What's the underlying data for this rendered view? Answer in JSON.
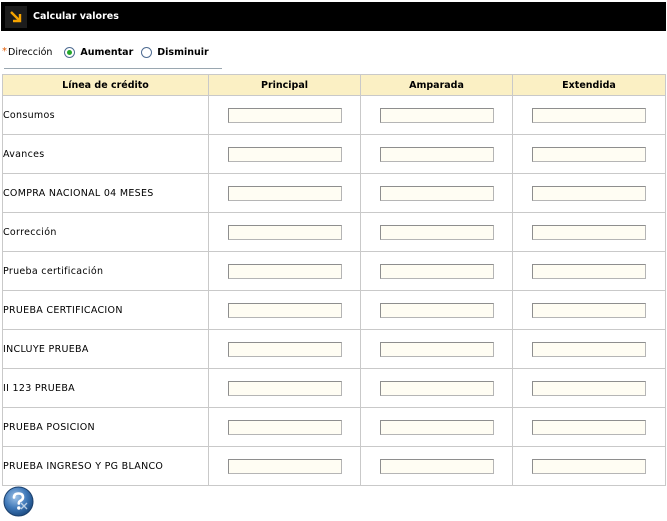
{
  "window": {
    "title": "Calcular valores"
  },
  "direction": {
    "label": "Dirección",
    "required_marker": "*",
    "options": [
      {
        "label": "Aumentar",
        "selected": true
      },
      {
        "label": "Disminuir",
        "selected": false
      }
    ]
  },
  "table": {
    "headers": [
      "Línea de crédito",
      "Principal",
      "Amparada",
      "Extendida"
    ],
    "rows": [
      {
        "name": "Consumos"
      },
      {
        "name": "Avances"
      },
      {
        "name": "COMPRA NACIONAL 04 MESES"
      },
      {
        "name": "Corrección"
      },
      {
        "name": "Prueba certificación"
      },
      {
        "name": "PRUEBA CERTIFICACION"
      },
      {
        "name": "INCLUYE PRUEBA"
      },
      {
        "name": "II 123 PRUEBA"
      },
      {
        "name": "PRUEBA POSICION"
      },
      {
        "name": "PRUEBA INGRESO Y PG BLANCO"
      }
    ]
  },
  "icons": {
    "title": "arrow-down-right-icon",
    "help": "help-icon"
  },
  "colors": {
    "title_bar": "#000000",
    "title_icon_arrow": "#f5a300",
    "header_bg": "#fbf0c4",
    "input_bg": "#fffdf3",
    "radio_selected": "#25a82b",
    "required": "#e05a00"
  }
}
